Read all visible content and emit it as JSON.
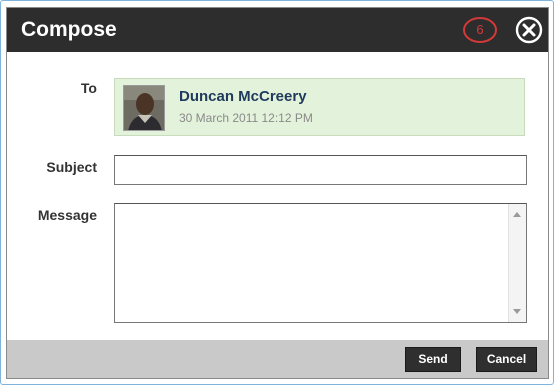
{
  "dialog": {
    "title": "Compose",
    "badge_number": "6",
    "close_icon": "close-circle-icon"
  },
  "form": {
    "to_label": "To",
    "subject_label": "Subject",
    "message_label": "Message",
    "subject_value": "",
    "message_value": ""
  },
  "recipient": {
    "name": "Duncan McCreery",
    "date": "30 March 2011 12:12 PM",
    "avatar_icon": "user-photo"
  },
  "footer": {
    "send_label": "Send",
    "cancel_label": "Cancel"
  },
  "colors": {
    "titlebar": "#2d2d2d",
    "recipient_bg": "#e3f2da",
    "footer_bg": "#c9c9c9",
    "button_bg": "#2f2f2f",
    "badge": "#d23a3a"
  }
}
